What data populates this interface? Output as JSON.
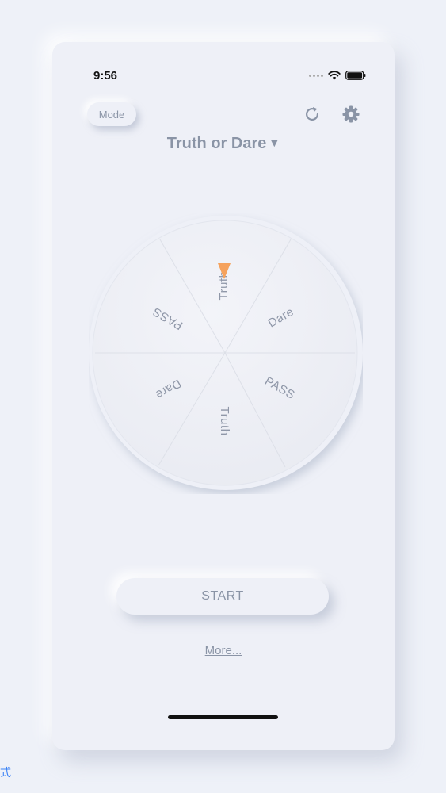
{
  "status_bar": {
    "time": "9:56"
  },
  "header": {
    "mode_label": "Mode",
    "title": "Truth or Dare",
    "title_caret": "▼"
  },
  "wheel": {
    "segments": [
      "Truth",
      "Dare",
      "PASS",
      "Truth",
      "Dare",
      "PASS"
    ],
    "pointer_color": "#f5a25d"
  },
  "actions": {
    "start_label": "START",
    "more_label": "More..."
  },
  "side_label": "式"
}
